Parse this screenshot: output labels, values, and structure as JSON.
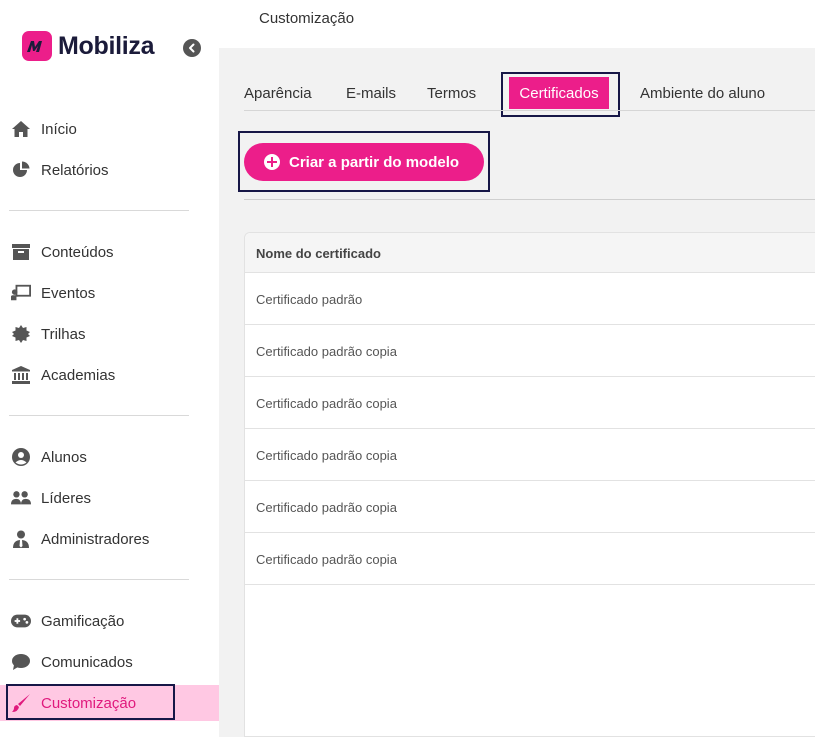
{
  "brand": {
    "name": "Mobiliza",
    "accent": "#ec1e8a",
    "dark": "#171747"
  },
  "header": {
    "title": "Customização"
  },
  "sidebar": {
    "items": [
      {
        "label": "Início",
        "icon": "home-icon"
      },
      {
        "label": "Relatórios",
        "icon": "pie-chart-icon"
      },
      {
        "label": "Conteúdos",
        "icon": "archive-box-icon"
      },
      {
        "label": "Eventos",
        "icon": "presentation-icon"
      },
      {
        "label": "Trilhas",
        "icon": "badge-icon"
      },
      {
        "label": "Academias",
        "icon": "institution-icon"
      },
      {
        "label": "Alunos",
        "icon": "user-circle-icon"
      },
      {
        "label": "Líderes",
        "icon": "users-icon"
      },
      {
        "label": "Administradores",
        "icon": "user-tie-icon"
      },
      {
        "label": "Gamificação",
        "icon": "gamepad-icon"
      },
      {
        "label": "Comunicados",
        "icon": "comment-icon"
      },
      {
        "label": "Customização",
        "icon": "paintbrush-icon",
        "active": true
      }
    ]
  },
  "tabs": [
    {
      "label": "Aparência"
    },
    {
      "label": "E-mails"
    },
    {
      "label": "Termos"
    },
    {
      "label": "Certificados",
      "active": true
    },
    {
      "label": "Ambiente do aluno"
    }
  ],
  "actions": {
    "create_label": "Criar a partir do modelo"
  },
  "table": {
    "header": "Nome do certificado",
    "rows": [
      "Certificado padrão",
      "Certificado padrão copia",
      "Certificado padrão copia",
      "Certificado padrão copia",
      "Certificado padrão copia",
      "Certificado padrão copia"
    ]
  }
}
